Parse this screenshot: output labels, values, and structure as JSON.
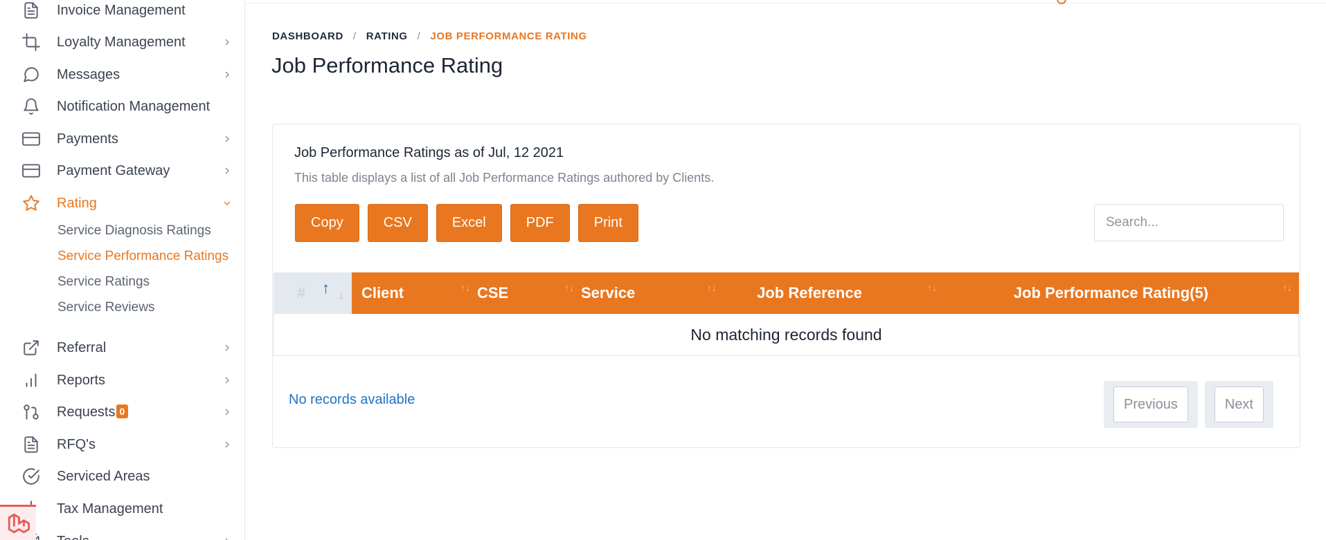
{
  "sidebar": {
    "items": [
      {
        "label": "Invoice Management",
        "icon": "document-icon"
      },
      {
        "label": "Loyalty Management",
        "icon": "crop-icon"
      },
      {
        "label": "Messages",
        "icon": "message-circle-icon"
      },
      {
        "label": "Notification Management",
        "icon": "bell-icon"
      },
      {
        "label": "Payments",
        "icon": "credit-card-icon"
      },
      {
        "label": "Payment Gateway",
        "icon": "credit-card-icon"
      },
      {
        "label": "Rating",
        "icon": "star-icon"
      },
      {
        "label": "Referral",
        "icon": "external-link-icon"
      },
      {
        "label": "Reports",
        "icon": "bar-chart-icon"
      },
      {
        "label": "Requests",
        "icon": "git-pull-request-icon",
        "badge": "0"
      },
      {
        "label": "RFQ's",
        "icon": "document-icon"
      },
      {
        "label": "Serviced Areas",
        "icon": "check-circle-icon"
      },
      {
        "label": "Tax Management",
        "icon": "tax-icon"
      },
      {
        "label": "Tools",
        "icon": "tool-icon"
      }
    ],
    "rating_sub": [
      "Service Diagnosis Ratings",
      "Service Performance Ratings",
      "Service Ratings",
      "Service Reviews"
    ]
  },
  "breadcrumb": [
    "DASHBOARD",
    "RATING",
    "JOB PERFORMANCE RATING"
  ],
  "page_title": "Job Performance Rating",
  "card": {
    "title": "Job Performance Ratings as of Jul, 12 2021",
    "subtitle": "This table displays a list of all Job Performance Ratings authored by Clients.",
    "buttons": [
      "Copy",
      "CSV",
      "Excel",
      "PDF",
      "Print"
    ],
    "search_placeholder": "Search..."
  },
  "table": {
    "columns": [
      "#",
      "Client",
      "CSE",
      "Service",
      "Job Reference",
      "Job Performance Rating(5)"
    ],
    "empty_message": "No matching records found"
  },
  "footer": {
    "records_info": "No records available",
    "prev_label": "Previous",
    "next_label": "Next"
  },
  "colors": {
    "accent": "#e9771f",
    "link": "#1e74c4"
  }
}
